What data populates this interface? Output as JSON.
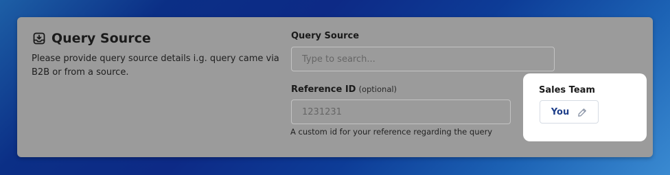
{
  "section": {
    "title": "Query Source",
    "title_icon": "inbox-download-icon",
    "description": "Please provide query source details i.g. query came via B2B or from a source."
  },
  "query_source_field": {
    "label": "Query Source",
    "placeholder": "Type to search...",
    "value": ""
  },
  "reference_field": {
    "label": "Reference ID",
    "optional_label": "(optional)",
    "placeholder": "1231231",
    "value": "",
    "help_text": "A custom id for your reference regarding the query"
  },
  "sales_team": {
    "label": "Sales Team",
    "chip_label": "You",
    "chip_icon": "pencil-icon",
    "accent_color": "#1f3f8a"
  },
  "colors": {
    "card_background": "#9b9b9b",
    "popup_background": "#ffffff"
  }
}
